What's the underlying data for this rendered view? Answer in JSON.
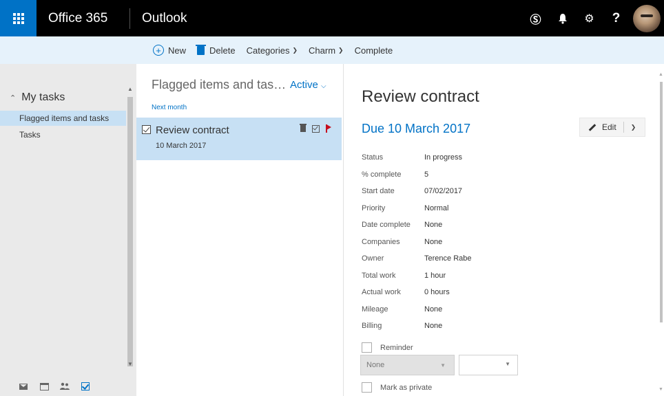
{
  "header": {
    "brand": "Office 365",
    "app": "Outlook",
    "icons": [
      "skype-icon",
      "bell-icon",
      "gear-icon",
      "help-icon"
    ],
    "skype_glyph": "Ⓢ",
    "bell_glyph": "🔔",
    "gear_glyph": "⚙",
    "help_glyph": "?"
  },
  "toolbar": {
    "new_label": "New",
    "delete_label": "Delete",
    "categories_label": "Categories",
    "charm_label": "Charm",
    "complete_label": "Complete"
  },
  "sidebar": {
    "section_label": "My tasks",
    "items": [
      {
        "label": "Flagged items and tasks",
        "selected": true
      },
      {
        "label": "Tasks",
        "selected": false
      }
    ]
  },
  "list": {
    "title": "Flagged items and tas…",
    "filter_label": "Active",
    "group_label": "Next month",
    "items": [
      {
        "title": "Review contract",
        "date": "10 March 2017"
      }
    ]
  },
  "detail": {
    "title": "Review contract",
    "due": "Due 10 March 2017",
    "edit_label": "Edit",
    "properties": [
      {
        "key": "Status",
        "value": "In progress"
      },
      {
        "key": "% complete",
        "value": "5"
      },
      {
        "key": "Start date",
        "value": "07/02/2017"
      },
      {
        "key": "Priority",
        "value": "Normal"
      },
      {
        "key": "Date complete",
        "value": "None"
      },
      {
        "key": "Companies",
        "value": "None"
      },
      {
        "key": "Owner",
        "value": "Terence Rabe"
      },
      {
        "key": "Total work",
        "value": "1 hour"
      },
      {
        "key": "Actual work",
        "value": "0 hours"
      },
      {
        "key": "Mileage",
        "value": "None"
      },
      {
        "key": "Billing",
        "value": "None"
      }
    ],
    "reminder_label": "Reminder",
    "reminder_value": "None",
    "private_label": "Mark as private"
  },
  "colors": {
    "accent": "#0072c6",
    "selection": "#c7e0f4",
    "commandbar": "#e6f2fb",
    "nav": "#eaeaea",
    "flag": "#c50f1f"
  }
}
